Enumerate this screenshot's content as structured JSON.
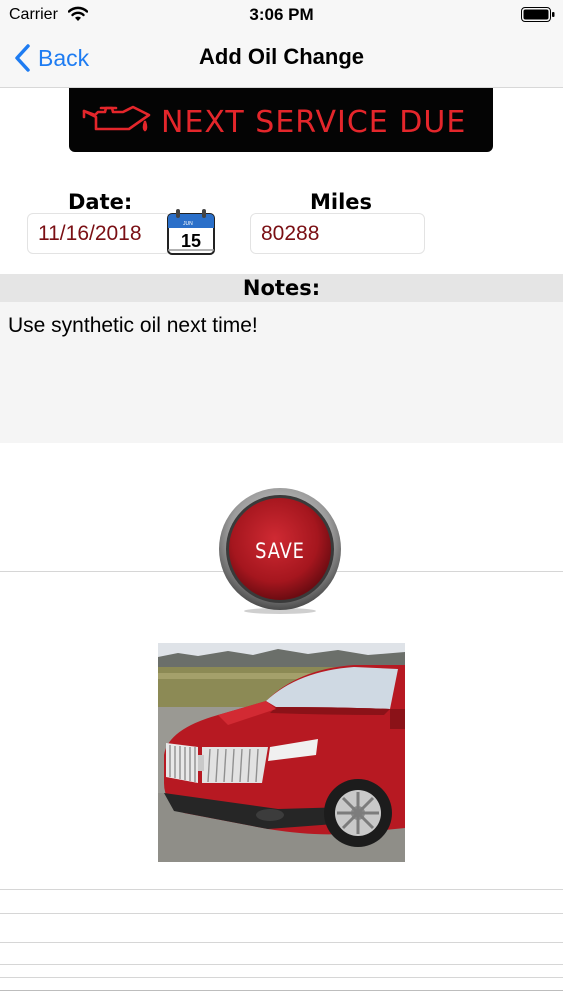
{
  "status_bar": {
    "carrier": "Carrier",
    "time": "3:06 PM"
  },
  "nav": {
    "back_label": "Back",
    "title": "Add Oil Change"
  },
  "banner": {
    "text": "NEXT SERVICE DUE",
    "text_color": "#e4262b"
  },
  "form": {
    "date_label": "Date:",
    "date_value": "11/16/2018",
    "calendar_day": "15",
    "calendar_month": "JUN",
    "miles_label": "Miles",
    "miles_value": "80288",
    "notes_label": "Notes:",
    "notes_value": "Use synthetic oil next time!"
  },
  "save_button": {
    "label": "SAVE",
    "color": "#b21c24"
  },
  "colors": {
    "accent": "#1e7cf2",
    "field_text": "#7a0f14"
  }
}
